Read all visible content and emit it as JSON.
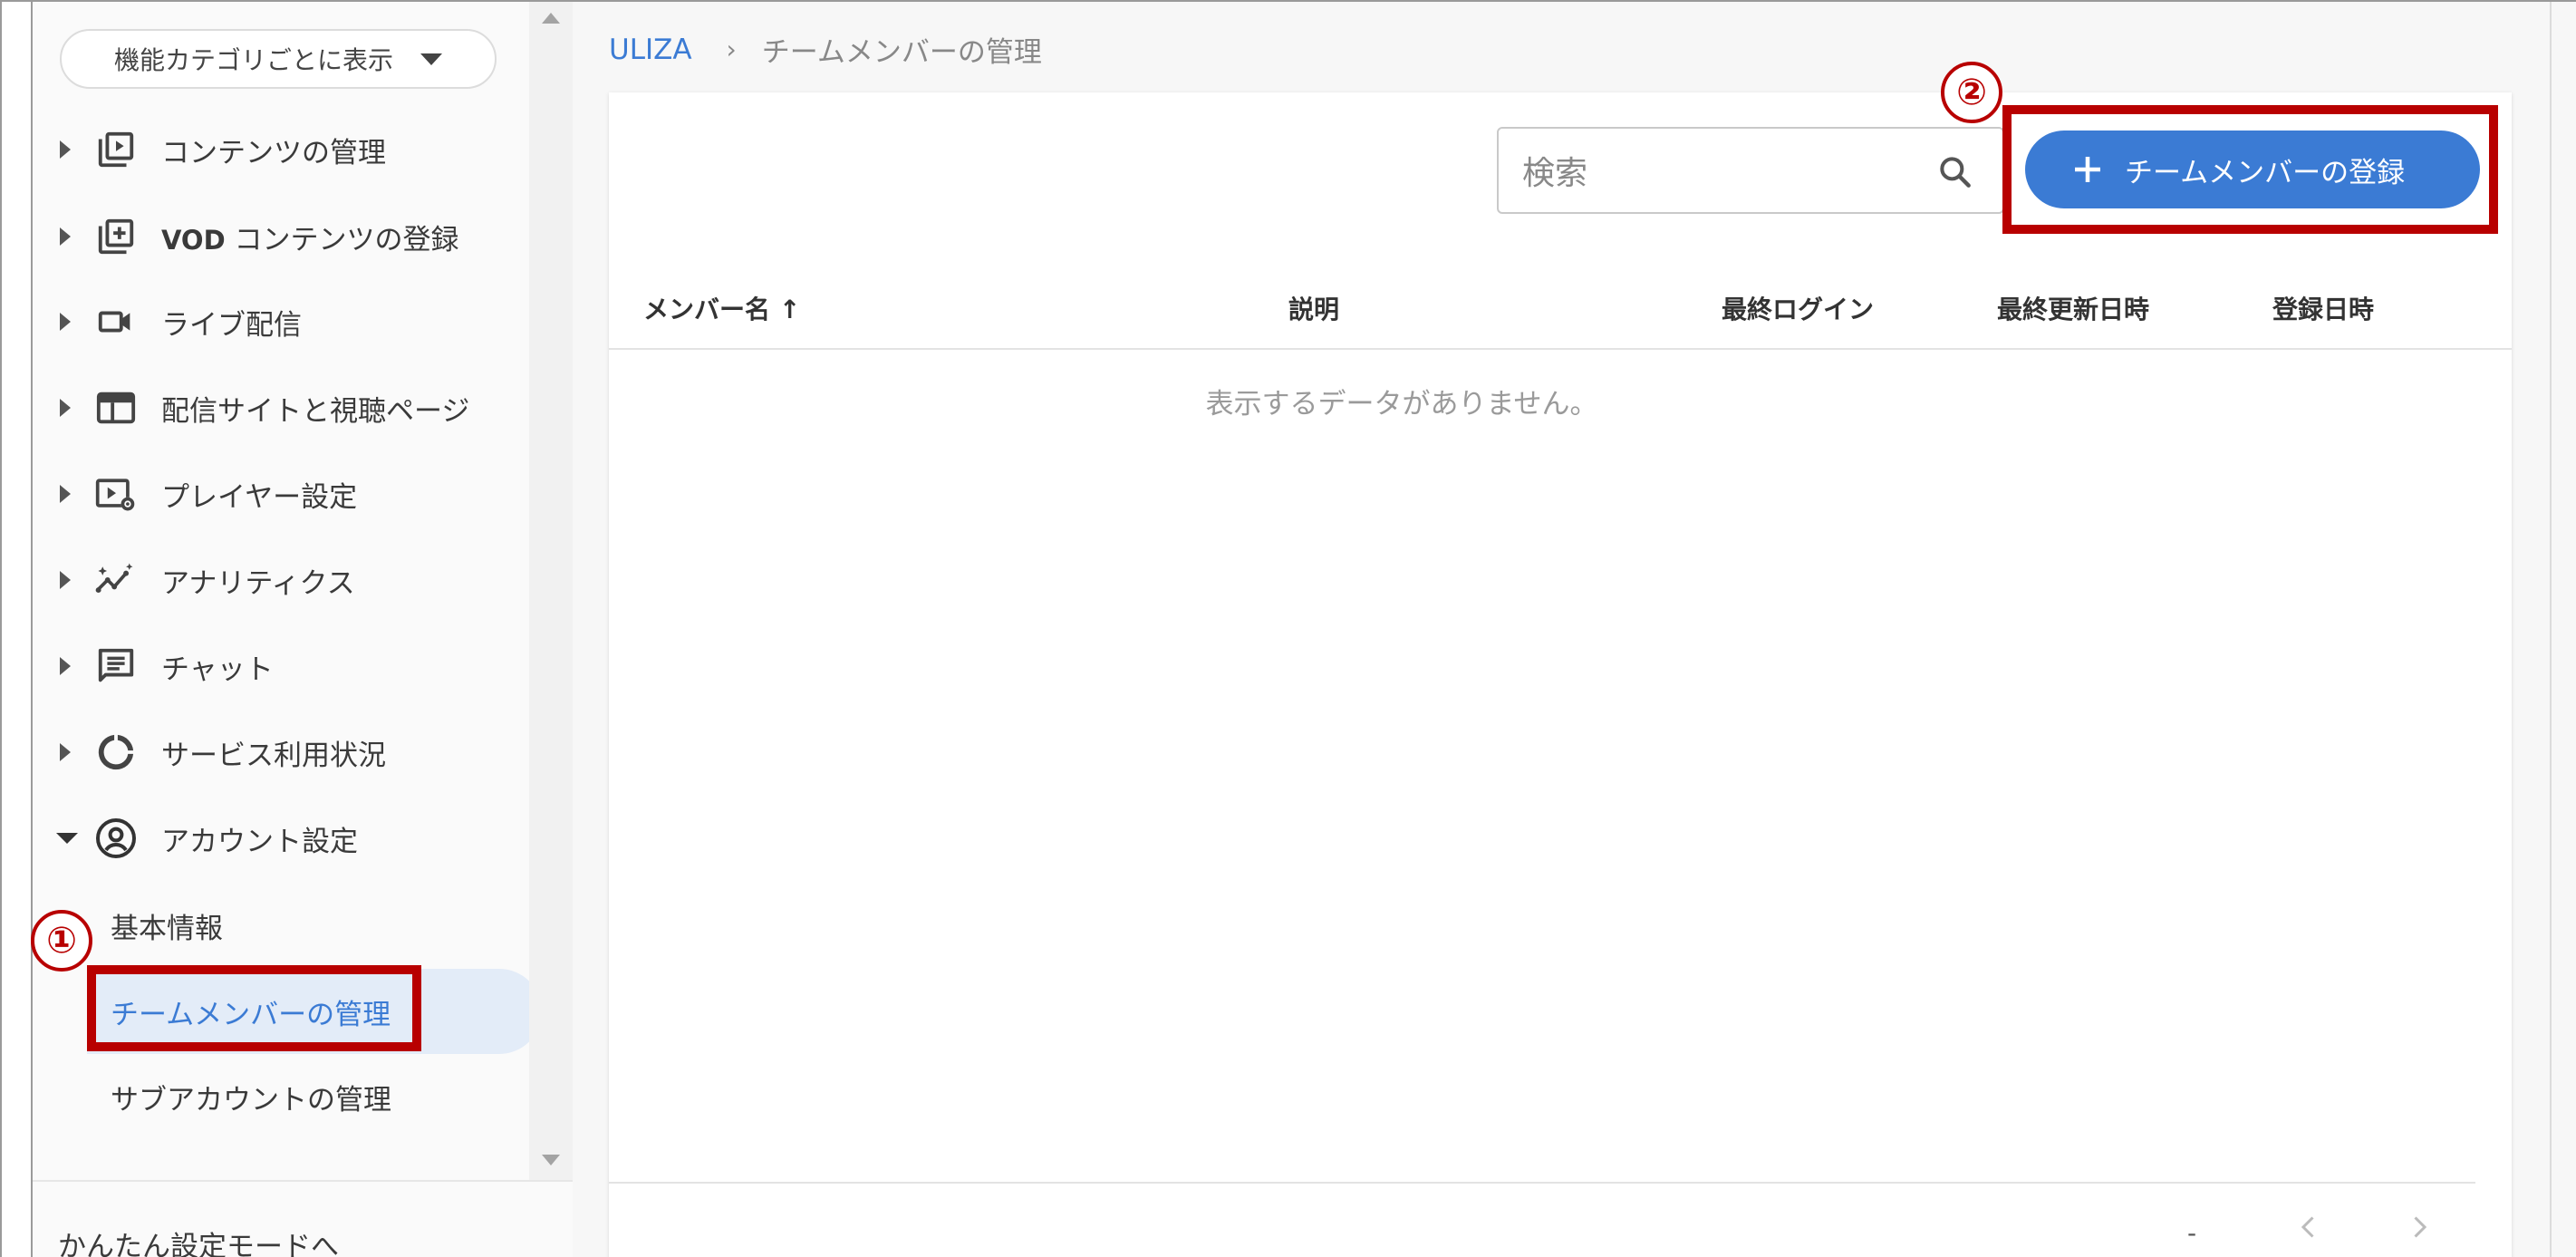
{
  "sidebar": {
    "category_select": "機能カテゴリごとに表示",
    "items": [
      {
        "label_prefix": "",
        "label": "コンテンツの管理",
        "icon": "play-box-icon"
      },
      {
        "label_prefix": "VOD",
        "label": " コンテンツの登録",
        "icon": "plus-box-icon"
      },
      {
        "label_prefix": "",
        "label": "ライブ配信",
        "icon": "video-camera-icon"
      },
      {
        "label_prefix": "",
        "label": "配信サイトと視聴ページ",
        "icon": "web-page-icon"
      },
      {
        "label_prefix": "",
        "label": "プレイヤー設定",
        "icon": "player-settings-icon"
      },
      {
        "label_prefix": "",
        "label": "アナリティクス",
        "icon": "analytics-icon"
      },
      {
        "label_prefix": "",
        "label": "チャット",
        "icon": "chat-icon"
      },
      {
        "label_prefix": "",
        "label": "サービス利用状況",
        "icon": "usage-donut-icon"
      },
      {
        "label_prefix": "",
        "label": "アカウント設定",
        "icon": "account-circle-icon"
      }
    ],
    "sub_items": [
      {
        "label": "基本情報"
      },
      {
        "label": "チームメンバーの管理"
      },
      {
        "label": "サブアカウントの管理"
      }
    ],
    "easy_mode": "かんたん設定モードへ"
  },
  "breadcrumb": {
    "root": "ULIZA",
    "separator": "›",
    "current": "チームメンバーの管理"
  },
  "toolbar": {
    "search_placeholder": "検索",
    "add_button": "チームメンバーの登録"
  },
  "table": {
    "columns": [
      "メンバー名",
      "説明",
      "最終ログイン",
      "最終更新日時",
      "登録日時"
    ],
    "sort_indicator": "↑",
    "empty_message": "表示するデータがありません。"
  },
  "pagination": {
    "range": "-"
  },
  "annotations": [
    "①",
    "②"
  ],
  "colors": {
    "accent": "#3b7bd4",
    "active_bg": "#e3ecf8",
    "annotation": "#b80000"
  }
}
